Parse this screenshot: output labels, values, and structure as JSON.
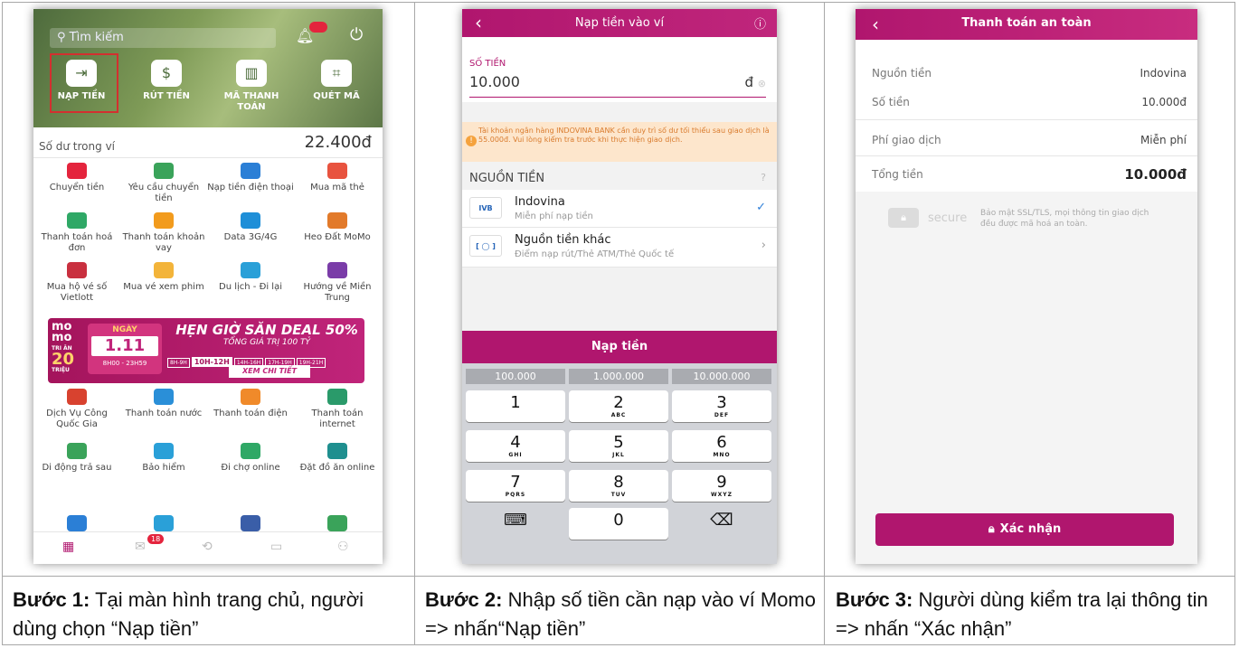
{
  "step1": {
    "search_placeholder": "Tìm kiếm",
    "actions": [
      "NẠP TIỀN",
      "RÚT TIỀN",
      "MÃ THANH TOÁN",
      "QUÉT MÃ"
    ],
    "balance_label": "Số dư trong ví",
    "balance_value": "22.400đ",
    "services": [
      "Chuyển tiền",
      "Yêu cầu chuyển tiền",
      "Nạp tiền điện thoại",
      "Mua mã thẻ",
      "Thanh toán hoá đơn",
      "Thanh toán khoản vay",
      "Data 3G/4G",
      "Heo Đất MoMo",
      "Mua hộ vé số Vietlott",
      "Mua vé xem phim",
      "Du lịch - Đi lại",
      "Hướng về Miền Trung",
      "Dịch Vụ Công Quốc Gia",
      "Thanh toán nước",
      "Thanh toán điện",
      "Thanh toán internet",
      "Di động trả sau",
      "Bảo hiểm",
      "Đi chợ online",
      "Đặt đồ ăn online"
    ],
    "banner": {
      "logo": "mo mo",
      "tri_an": "TRI ÂN",
      "amount": "20",
      "amount_unit": "TRIỆU",
      "day_label": "NGÀY",
      "date": "1.11",
      "time": "8H00 - 23H59",
      "headline": "HẸN GIỜ SĂN DEAL 50%",
      "sub": "TỔNG GIÁ TRỊ 100 TỶ",
      "slots": [
        "8H-9H",
        "10H-12H",
        "14H-16H",
        "17H-19H",
        "19H-21H"
      ],
      "cta": "XEM CHI TIẾT"
    },
    "nav_badge": "18",
    "caption_bold": "Bước 1:",
    "caption_text": "Tại màn hình trang chủ, người dùng chọn “Nạp tiền”"
  },
  "step2": {
    "title": "Nạp tiền vào ví",
    "amount_label": "SỐ TIỀN",
    "amount_value": "10.000",
    "currency": "đ",
    "warning": "Tài khoản ngân hàng INDOVINA BANK cần duy trì số dư tối thiểu sau giao dịch là 55.000đ. Vui lòng kiểm tra trước khi thực hiện giao dịch.",
    "source_header": "NGUỒN TIỀN",
    "options": [
      {
        "logo": "IVB",
        "name": "Indovina",
        "desc": "Miễn phí nạp tiền",
        "end": "✓"
      },
      {
        "logo": "[ ◯ ]",
        "name": "Nguồn tiền khác",
        "desc": "Điểm nạp rút/Thẻ ATM/Thẻ Quốc tế",
        "end": "›"
      }
    ],
    "button": "Nạp tiền",
    "quick_amounts": [
      "100.000",
      "1.000.000",
      "10.000.000"
    ],
    "keys": [
      {
        "k": "1",
        "s": ""
      },
      {
        "k": "2",
        "s": "ABC"
      },
      {
        "k": "3",
        "s": "DEF"
      },
      {
        "k": "4",
        "s": "GHI"
      },
      {
        "k": "5",
        "s": "JKL"
      },
      {
        "k": "6",
        "s": "MNO"
      },
      {
        "k": "7",
        "s": "PQRS"
      },
      {
        "k": "8",
        "s": "TUV"
      },
      {
        "k": "9",
        "s": "WXYZ"
      },
      {
        "k": "⌨",
        "s": ""
      },
      {
        "k": "0",
        "s": ""
      },
      {
        "k": "⌫",
        "s": ""
      }
    ],
    "caption_bold": "Bước 2:",
    "caption_text": "Nhập số tiền cần nạp vào ví Momo => nhấn“Nạp tiền”"
  },
  "step3": {
    "title": "Thanh toán an toàn",
    "rows": [
      {
        "label": "Nguồn tiền",
        "value": "Indovina"
      },
      {
        "label": "Số tiền",
        "value": "10.000đ"
      },
      {
        "label": "Phí giao dịch",
        "value": "Miễn phí"
      },
      {
        "label": "Tổng tiền",
        "value": "10.000đ"
      }
    ],
    "secure_word": "secure",
    "secure_text": "Bảo mật SSL/TLS, mọi thông tin giao dịch đều được mã hoá an toàn.",
    "button": "Xác nhận",
    "caption_bold": "Bước 3:",
    "caption_text": "Người dùng kiểm tra lại thông tin => nhấn “Xác nhận”"
  },
  "colors": {
    "momo_pink": "#b0166e",
    "select_red": "#d32f2f"
  }
}
